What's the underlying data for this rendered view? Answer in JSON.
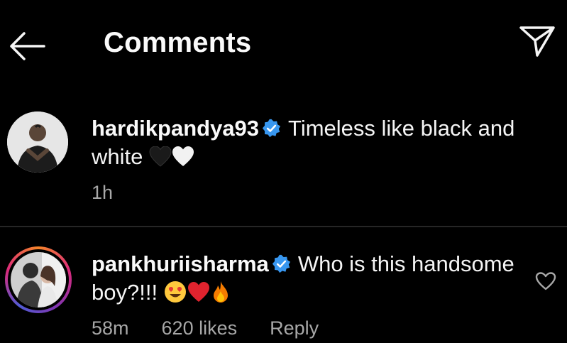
{
  "header": {
    "title": "Comments",
    "back_icon": "arrow-left-icon",
    "share_icon": "paper-plane-icon"
  },
  "comments": [
    {
      "username": "hardikpandya93",
      "verified": true,
      "text": "Timeless like black and white",
      "emojis": [
        "black-heart",
        "white-heart"
      ],
      "time": "1h"
    },
    {
      "username": "pankhuriisharma",
      "verified": true,
      "text": "Who is this handsome boy?!!!",
      "emojis": [
        "heart-eyes-face",
        "red-heart",
        "fire"
      ],
      "time": "58m",
      "likes": "620 likes",
      "reply_label": "Reply",
      "has_story_ring": true
    }
  ],
  "colors": {
    "background": "#000000",
    "text": "#f5f5f5",
    "secondary_text": "#a8a8a8",
    "verified_blue": "#3897f0",
    "divider": "#262626"
  }
}
